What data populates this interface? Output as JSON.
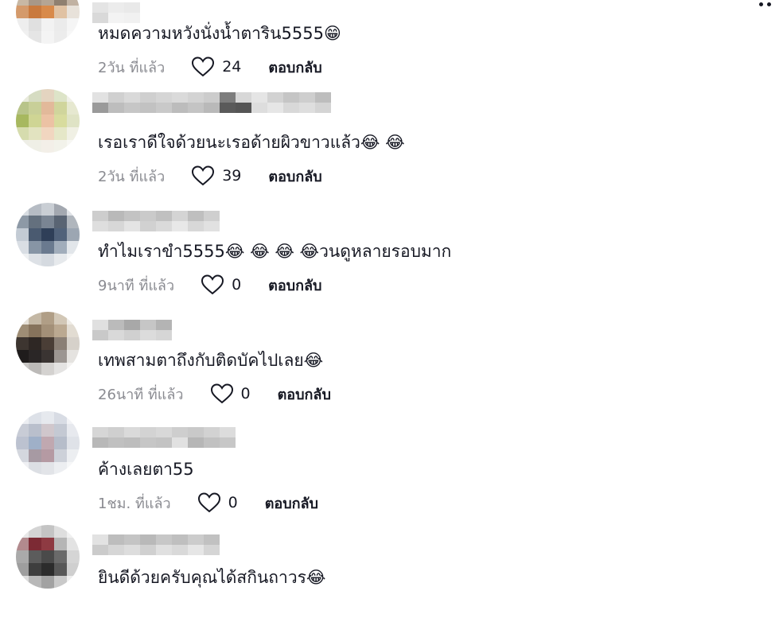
{
  "header": {
    "more_icon": "more-options-icon"
  },
  "colors": {
    "text": "#161823",
    "meta": "#8a8b91",
    "background": "#ffffff"
  },
  "comments": [
    {
      "text": "หมดความหวังนั่งน้ำตาริน5555",
      "emoji": "😁",
      "time": "2วัน ที่แล้ว",
      "likes": "24",
      "reply": "ตอบกลับ"
    },
    {
      "text": "เรอเราดีใจด้วยนะเรอด้ายผิวขาวแล้ว",
      "emoji": "😂 😂",
      "time": "2วัน ที่แล้ว",
      "likes": "39",
      "reply": "ตอบกลับ"
    },
    {
      "text": "ทำไมเราขำ5555",
      "emoji": "😂 😂 😂 😂",
      "text_after": "วนดูหลายรอบมาก",
      "time": "9นาที ที่แล้ว",
      "likes": "0",
      "reply": "ตอบกลับ"
    },
    {
      "text": "เทพสามตาถึงกับติดบัคไปเลย",
      "emoji": "😂",
      "time": "26นาที ที่แล้ว",
      "likes": "0",
      "reply": "ตอบกลับ"
    },
    {
      "text": "ค้างเลยตา55",
      "emoji": "",
      "time": "1ชม. ที่แล้ว",
      "likes": "0",
      "reply": "ตอบกลับ"
    },
    {
      "text": "ยินดีด้วยครับคุณได้สกินถาวร",
      "emoji": "😂",
      "time": "",
      "likes": "",
      "reply": ""
    }
  ]
}
